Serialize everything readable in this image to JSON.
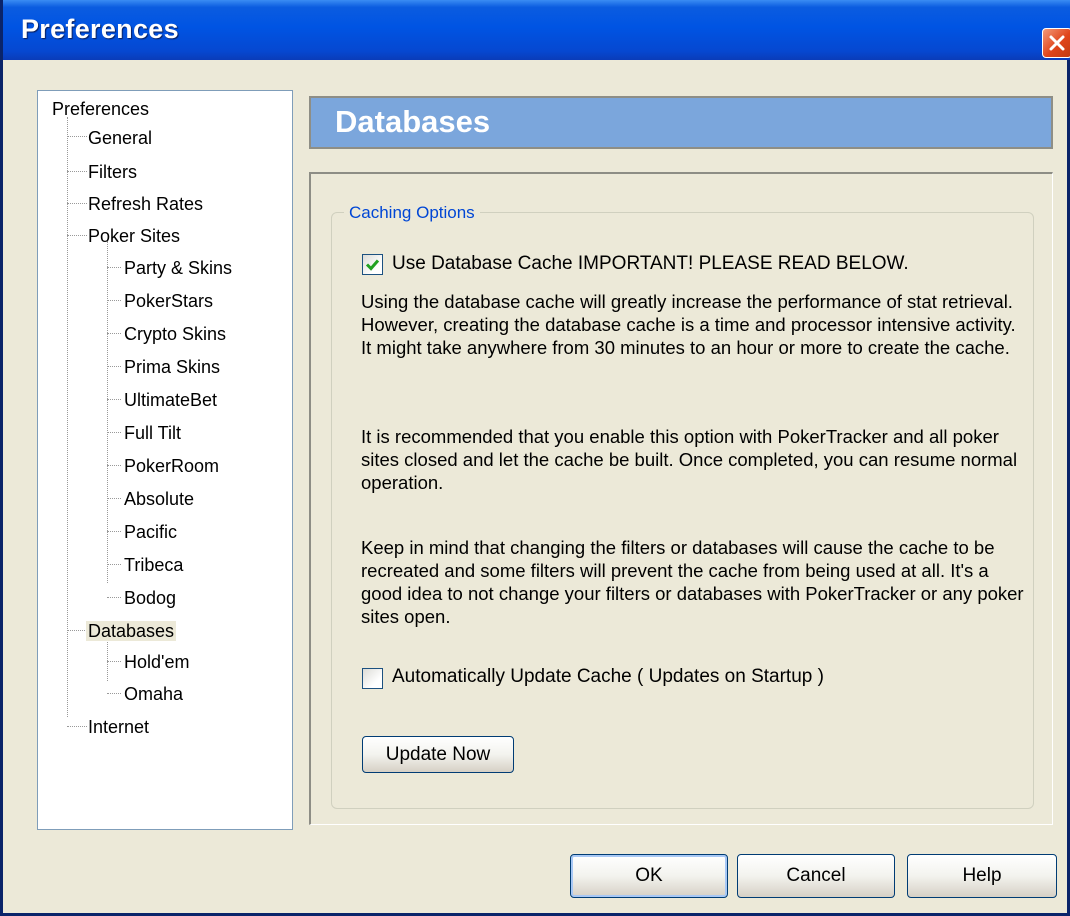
{
  "window": {
    "title": "Preferences"
  },
  "tree": {
    "root": "Preferences",
    "general": "General",
    "filters": "Filters",
    "refresh_rates": "Refresh Rates",
    "poker_sites": "Poker Sites",
    "party_skins": "Party & Skins",
    "pokerstars": "PokerStars",
    "crypto_skins": "Crypto Skins",
    "prima_skins": "Prima Skins",
    "ultimatebet": "UltimateBet",
    "full_tilt": "Full Tilt",
    "pokerroom": "PokerRoom",
    "absolute": "Absolute",
    "pacific": "Pacific",
    "tribeca": "Tribeca",
    "bodog": "Bodog",
    "databases": "Databases",
    "holdem": "Hold'em",
    "omaha": "Omaha",
    "internet": "Internet",
    "selected": "Databases"
  },
  "header": {
    "title": "Databases"
  },
  "caching": {
    "group_title": "Caching Options",
    "use_cache_label": "Use Database Cache    IMPORTANT!  PLEASE READ BELOW.",
    "use_cache_checked": true,
    "para1": "Using the database cache will greatly increase the performance of stat retrieval.  However, creating the database cache is a time and processor intensive activity.  It might take anywhere from 30 minutes to an hour or more to create the cache.",
    "para2": "It is recommended that you enable this option with PokerTracker and all poker sites closed and let the cache be built.  Once completed, you can resume normal operation.",
    "para3": "Keep in mind that changing the filters or databases will cause the cache to be recreated and some filters will prevent the cache from being used at all.  It's a good idea to not change your filters or databases with PokerTracker or any poker sites open.",
    "auto_update_label": "Automatically Update Cache ( Updates on Startup )",
    "auto_update_checked": false,
    "update_now": "Update Now"
  },
  "buttons": {
    "ok": "OK",
    "cancel": "Cancel",
    "help": "Help"
  },
  "colors": {
    "title_bar": "#0054E3",
    "header_band": "#7BA6DC",
    "group_title": "#0046D5",
    "dialog_bg": "#ECE9D8"
  },
  "icons": {
    "close": "close-x-icon",
    "checkbox_checked": "checkmark-icon"
  }
}
